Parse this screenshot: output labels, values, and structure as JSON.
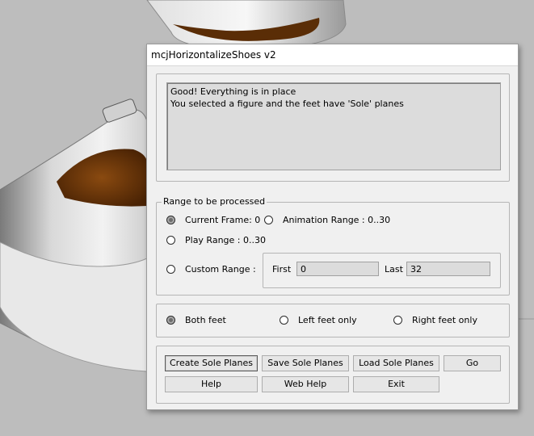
{
  "window": {
    "title": "mcjHorizontalizeShoes v2"
  },
  "status": {
    "lines": [
      "Good! Everything is in place",
      "You selected a figure and the feet have 'Sole' planes"
    ]
  },
  "range": {
    "group_label": "Range to be processed",
    "current_frame": {
      "label": "Current Frame: 0",
      "checked": true
    },
    "animation_range": {
      "label": "Animation Range : 0..30",
      "checked": false
    },
    "play_range": {
      "label": "Play Range : 0..30",
      "checked": false
    },
    "custom_range": {
      "label": "Custom Range :",
      "checked": false
    },
    "first": {
      "label": "First",
      "value": "0"
    },
    "last": {
      "label": "Last",
      "value": "32"
    }
  },
  "feet": {
    "both": {
      "label": "Both feet",
      "checked": true
    },
    "left": {
      "label": "Left feet only",
      "checked": false
    },
    "right": {
      "label": "Right feet only",
      "checked": false
    }
  },
  "buttons": {
    "create": "Create Sole Planes",
    "save": "Save Sole Planes",
    "load": "Load Sole Planes",
    "go": "Go",
    "help": "Help",
    "web_help": "Web Help",
    "exit": "Exit"
  },
  "colors": {
    "dialog_bg": "#f0f0f0",
    "viewport_bg": "#b9b9b9",
    "shoe_opening": "#6b3508"
  }
}
